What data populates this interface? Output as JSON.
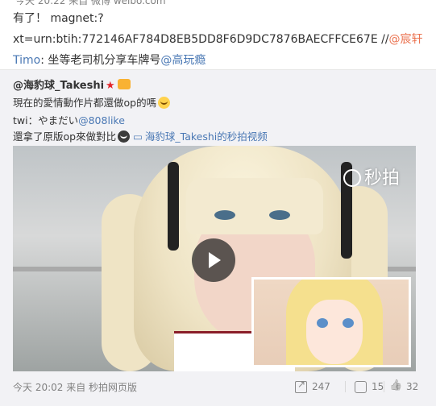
{
  "repost": {
    "top_meta": "今天 20:22 来自 微博 weibo.com",
    "line1": "有了！ magnet:?",
    "line2_prefix": "xt=urn:btih:772146AF784D8EB5DD8F6D9DC7876BAECFFCE67E //",
    "line2_mention": "@宸轩",
    "line3_user": "Timo",
    "line3_text": ": 坐等老司机分享车牌号",
    "line3_mention": "@高玩瘾"
  },
  "original": {
    "author": "@海豹球_Takeshi",
    "text1": "現在的愛情動作片都還做op的嗎",
    "text2_prefix": "twi：やまだい",
    "text2_mention": "@808like",
    "text3": "還拿了原版op來做對比",
    "video_link": "海豹球_Takeshi的秒拍视频",
    "watermark": "秒拍",
    "time": "今天 20:02 来自 秒拍网页版",
    "shares": "247",
    "comments": "15",
    "likes": "32"
  },
  "icons": [
    "star-icon",
    "member-badge-icon",
    "emoji-icon",
    "video-link-icon",
    "play-icon",
    "miaopai-logo-icon",
    "share-icon",
    "comment-icon",
    "like-icon"
  ],
  "colors": {
    "link_orange": "#eb7350",
    "link_blue": "#4a78b4",
    "card_bg": "#f2f2f5",
    "meta_gray": "#808080"
  }
}
